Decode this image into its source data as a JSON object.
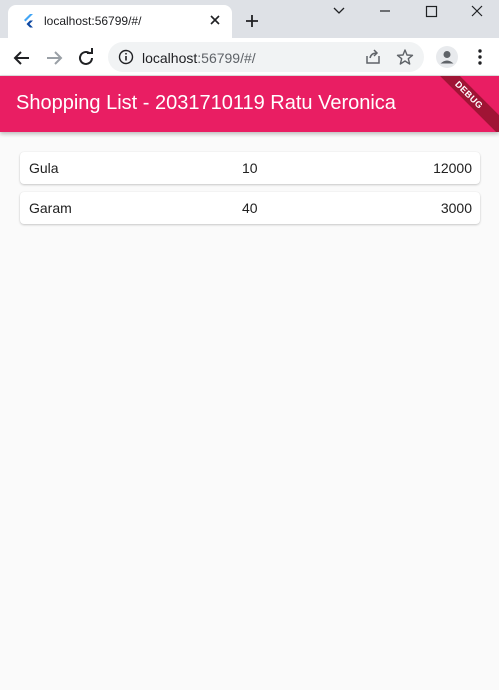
{
  "browser": {
    "tab_title": "localhost:56799/#/",
    "url_host": "localhost",
    "url_path": ":56799/#/"
  },
  "app": {
    "title": "Shopping List - 2031710119 Ratu Veronica",
    "debug_banner": "DEBUG",
    "accent_color": "#e91e63"
  },
  "items": [
    {
      "name": "Gula",
      "quantity": "10",
      "price": "12000"
    },
    {
      "name": "Garam",
      "quantity": "40",
      "price": "3000"
    }
  ]
}
